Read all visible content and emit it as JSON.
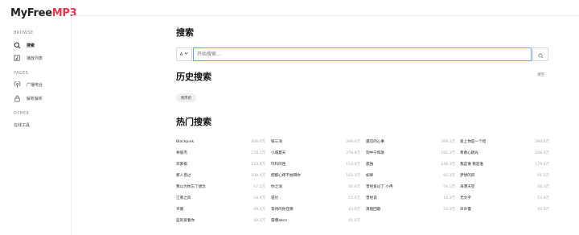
{
  "app": {
    "logo_main": "MyFree",
    "logo_accent": "MP3"
  },
  "sidebar": {
    "browse_label": "BROWSE",
    "pages_label": "PAGES",
    "other_label": "OTHER",
    "items": [
      {
        "label": "搜索",
        "icon": "search-icon",
        "active": true
      },
      {
        "label": "播放列表",
        "icon": "playlist-icon",
        "active": false
      },
      {
        "label": "广播电台",
        "icon": "radio-icon",
        "active": false
      },
      {
        "label": "解析解析",
        "icon": "lock-icon",
        "active": false
      },
      {
        "label": "在线工具",
        "icon": "",
        "active": false
      }
    ]
  },
  "search": {
    "heading": "搜索",
    "source": "A",
    "placeholder": "开始搜索..."
  },
  "history": {
    "heading": "历史搜索",
    "clear_label": "清空",
    "items": [
      "周杰伦"
    ]
  },
  "hot": {
    "heading": "热门搜索",
    "rows": [
      [
        {
          "name": "Blackpink",
          "count": "408.6万"
        },
        {
          "name": "张三洋",
          "count": "399.6万"
        },
        {
          "name": "遇见的心事",
          "count": "399.3万"
        },
        {
          "name": "爱上你是一个错",
          "count": "398.6万"
        }
      ],
      [
        {
          "name": "林俊杰",
          "count": "278.1万"
        },
        {
          "name": "小城夏天",
          "count": "278.8万"
        },
        {
          "name": "刻中宁和歌",
          "count": "182.3万"
        },
        {
          "name": "青春心跳光",
          "count": "168.4万"
        }
      ],
      [
        {
          "name": "邓紫棋",
          "count": "133.8万"
        },
        {
          "name": "玛玛的连",
          "count": "114.9万"
        },
        {
          "name": "孤独",
          "count": "148.3万"
        },
        {
          "name": "我是谁 我是谁",
          "count": "129.6万"
        }
      ],
      [
        {
          "name": "那人曾过",
          "count": "108.4万"
        },
        {
          "name": "把那心疼不妨碍你",
          "count": "102.3万"
        },
        {
          "name": "如果",
          "count": "95.3万"
        },
        {
          "name": "梦想的风",
          "count": "91.2万"
        }
      ],
      [
        {
          "name": "我以为你忘了想念",
          "count": "47.1万"
        },
        {
          "name": "你之谜",
          "count": "56.8万"
        },
        {
          "name": "曾经爱过了 小冉",
          "count": "54.1万"
        },
        {
          "name": "海港天空",
          "count": "48.3万"
        }
      ],
      [
        {
          "name": "江南之风",
          "count": "18.9万"
        },
        {
          "name": "遗价",
          "count": "15.6万"
        },
        {
          "name": "曾经说",
          "count": "14.3万"
        },
        {
          "name": "无文字",
          "count": "13.9万"
        }
      ],
      [
        {
          "name": "许嵩",
          "count": "49.2万"
        },
        {
          "name": "等待的你在哪",
          "count": "43.6万"
        },
        {
          "name": "演唱回歌",
          "count": "53.3万"
        },
        {
          "name": "声声慢",
          "count": "42.3万"
        }
      ],
      [
        {
          "name": "蓝的爱着你",
          "count": "48.3万"
        },
        {
          "name": "雷爆abcs",
          "count": "41.6万"
        }
      ]
    ]
  },
  "colors": {
    "accent": "#e8364e",
    "focus": "#6aa7f1"
  }
}
